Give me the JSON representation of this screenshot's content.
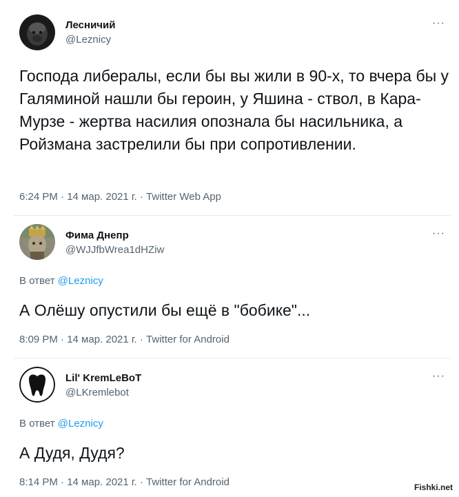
{
  "tweets": [
    {
      "name": "Лесничий",
      "handle": "@Leznicy",
      "reply_prefix": "",
      "reply_mention": "",
      "text": "Господа либералы, если бы вы жили в 90-х, то вчера бы у Галяминой нашли бы героин, у Яшина - ствол, в Кара- Мурзе - жертва насилия опознала бы насильника, а Ройзмана застрелили бы при сопротивлении.",
      "meta": "6:24 PM · 14 мар. 2021 г. · Twitter Web App",
      "more": "···"
    },
    {
      "name": "Фима Днепр",
      "handle": "@WJJfbWrea1dHZiw",
      "reply_prefix": "В ответ ",
      "reply_mention": "@Leznicy",
      "text": "А Олёшу опустили бы ещё в \"бобике\"...",
      "meta": "8:09 PM · 14 мар. 2021 г. · Twitter for Android",
      "more": "···"
    },
    {
      "name": "Lil' KremLeBoT",
      "handle": "@LKremlebot",
      "reply_prefix": "В ответ ",
      "reply_mention": "@Leznicy",
      "text": "А Дудя, Дудя?",
      "meta": "8:14 PM · 14 мар. 2021 г. · Twitter for Android",
      "more": "···"
    }
  ],
  "watermark": "Fishki.net",
  "colors": {
    "link": "#1d9bf0",
    "secondary": "#536471",
    "text": "#0f1419"
  }
}
